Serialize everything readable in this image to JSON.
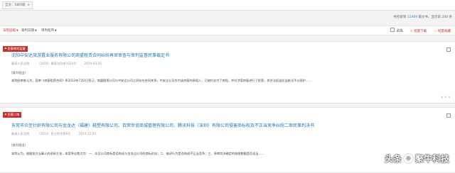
{
  "filter": {
    "chip_label": "全文：58同城",
    "remove_glyph": "×"
  },
  "summary": {
    "prefix": "共检索到",
    "count": "11469",
    "middle": "篇文书，显示前",
    "limit": "200",
    "suffix": "条"
  },
  "sort": {
    "items": [
      {
        "label": "法院层级",
        "active": true,
        "arrow": "▼"
      },
      {
        "label": "裁判日期",
        "active": false,
        "arrow": "▼"
      },
      {
        "label": "审判程序",
        "active": false,
        "arrow": "▼"
      }
    ],
    "select_all": "全选",
    "batch_download": "批量下载",
    "batch_collect": "批量收藏"
  },
  "cases": [
    {
      "badge": "民事审判监督",
      "title": "沈阳中安达旅游置业服务有限公司商盟租赁合同纠纷再审审查与审判监督民事裁定书",
      "court": "最高人民法院",
      "number": "（2019）最高法民申1024号",
      "date": "2019-03-25",
      "section": "[裁判理由]",
      "text": "本院经审查认为，庭审《房屋租赁合同》系2013年7月2日签订，商盟租赁公司与中安达公司之间存在合同关系，中安达公司作为该房屋的承租人，已按约支付了房租，并对涉案房屋进行了经营，其合法权益应当依法予以保护……",
      "more": "∨ ∨ ∨"
    },
    {
      "badge": "民事二审",
      "title": "东莞市众至针织有限公司与金龙达（福建）鞋塑有限公司、百荣世贸商城管理有限公司、腾讯科技（深圳）有限公司侵害商标权及不正当竞争纠纷二审民事判决书",
      "court": "最高人民法院",
      "number": "（2014）民三终字第8号",
      "date": "2014-12-02",
      "section": "[裁判理由]",
      "text": "本院认为，根据各方当事人的诉辩主张，本案争议焦点为：一、众至公司商标是否构成与金龙达公司的商标近似；二、被诉行为是否构成不正当竞争；三、原审判决确定的赔偿数额是否适当……",
      "more": ""
    }
  ],
  "watermark": {
    "prefix": "头条",
    "logo": "◎",
    "name": "聚牛科技"
  }
}
